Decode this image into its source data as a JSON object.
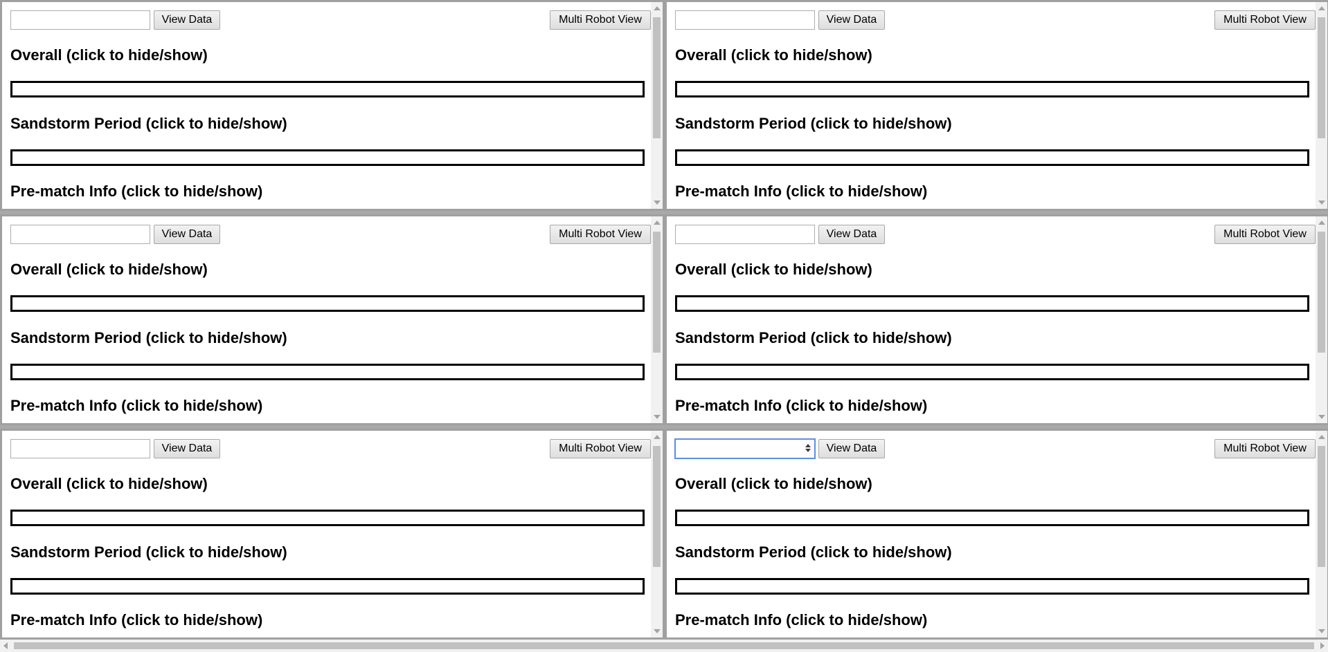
{
  "panels": [
    {
      "input_value": "",
      "view_label": "View Data",
      "multi_label": "Multi Robot View",
      "sections": [
        "Overall (click to hide/show)",
        "Sandstorm Period (click to hide/show)",
        "Pre-match Info (click to hide/show)"
      ]
    },
    {
      "input_value": "",
      "view_label": "View Data",
      "multi_label": "Multi Robot View",
      "sections": [
        "Overall (click to hide/show)",
        "Sandstorm Period (click to hide/show)",
        "Pre-match Info (click to hide/show)"
      ]
    },
    {
      "input_value": "",
      "view_label": "View Data",
      "multi_label": "Multi Robot View",
      "sections": [
        "Overall (click to hide/show)",
        "Sandstorm Period (click to hide/show)",
        "Pre-match Info (click to hide/show)"
      ]
    },
    {
      "input_value": "",
      "view_label": "View Data",
      "multi_label": "Multi Robot View",
      "sections": [
        "Overall (click to hide/show)",
        "Sandstorm Period (click to hide/show)",
        "Pre-match Info (click to hide/show)"
      ]
    },
    {
      "input_value": "",
      "view_label": "View Data",
      "multi_label": "Multi Robot View",
      "sections": [
        "Overall (click to hide/show)",
        "Sandstorm Period (click to hide/show)",
        "Pre-match Info (click to hide/show)"
      ]
    },
    {
      "input_value": "",
      "view_label": "View Data",
      "multi_label": "Multi Robot View",
      "sections": [
        "Overall (click to hide/show)",
        "Sandstorm Period (click to hide/show)",
        "Pre-match Info (click to hide/show)"
      ],
      "focused": true
    }
  ],
  "colors": {
    "panel_border": "#a0a0a0",
    "bar_border": "#000000",
    "focus": "#5b8fe0"
  },
  "icons": {
    "scroll_up": "triangle-up",
    "scroll_down": "triangle-down",
    "spinner": "number-spinner"
  }
}
